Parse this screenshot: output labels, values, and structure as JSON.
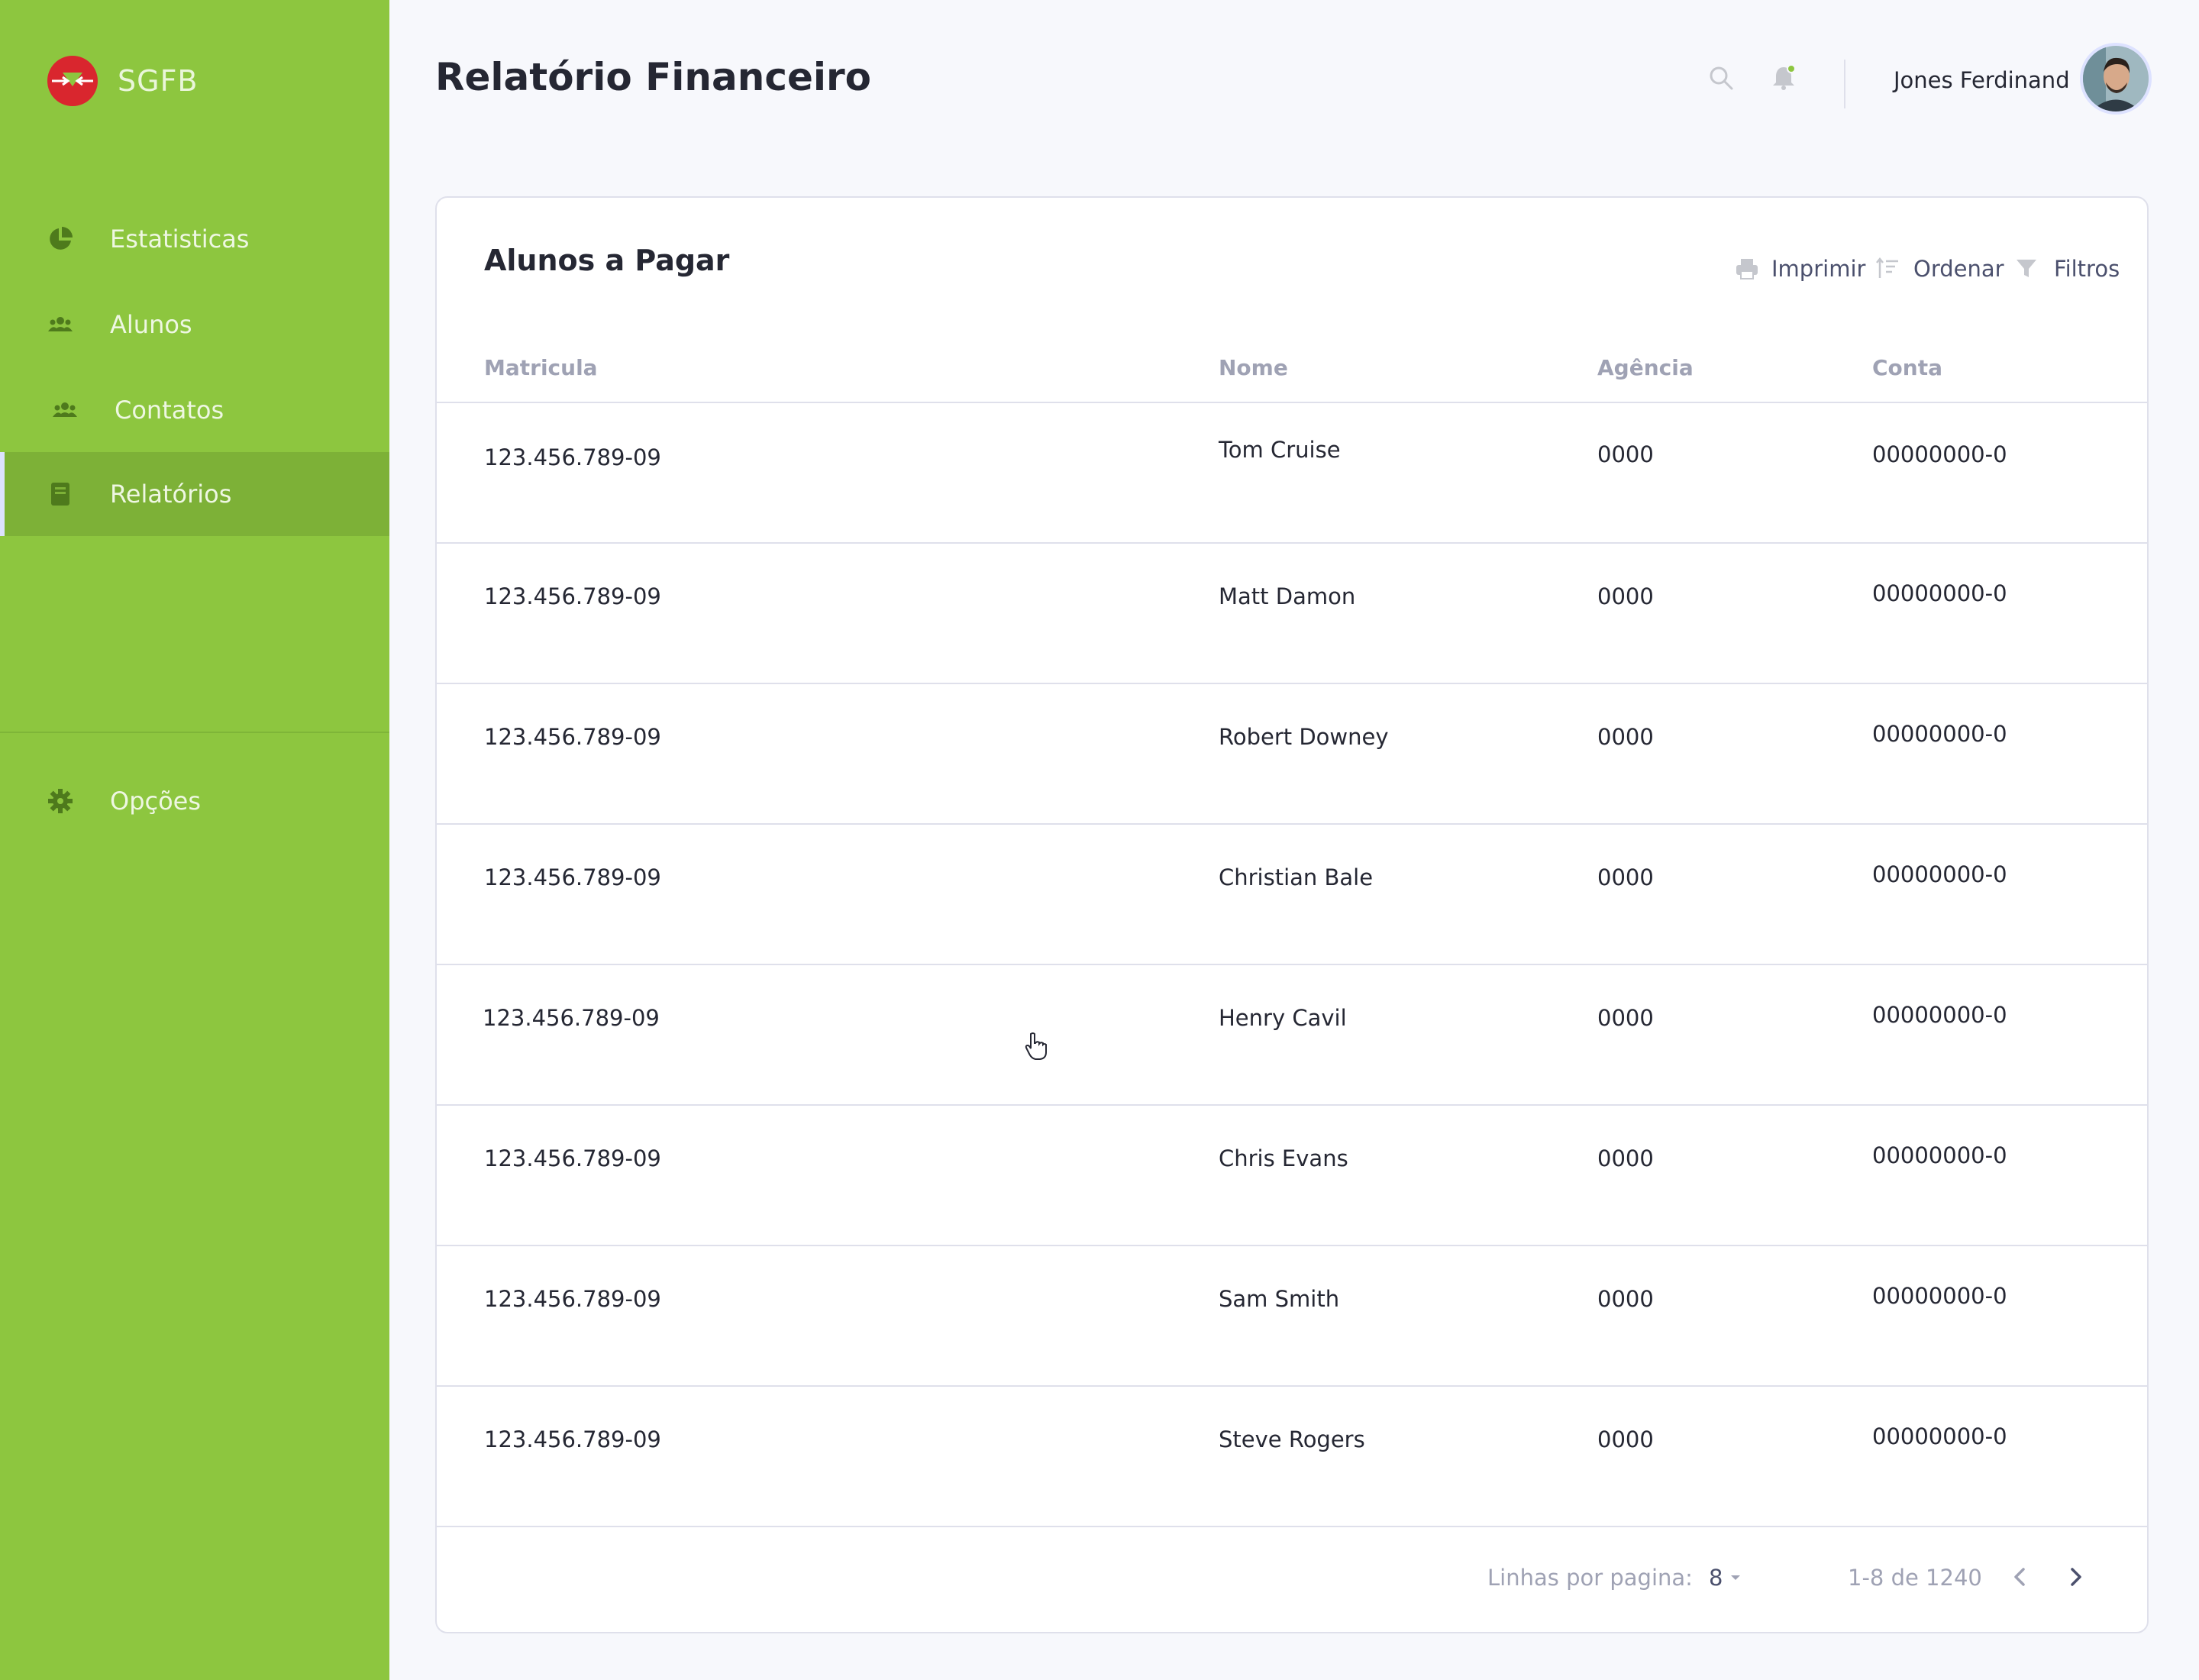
{
  "app": {
    "brand": "SGFB"
  },
  "sidebar": {
    "items": [
      {
        "label": "Estatisticas",
        "icon": "pie-chart-icon"
      },
      {
        "label": "Alunos",
        "icon": "users-icon"
      },
      {
        "label": "Contatos",
        "icon": "users-icon"
      },
      {
        "label": "Relatórios",
        "icon": "book-icon",
        "active": true
      }
    ],
    "options": {
      "label": "Opções",
      "icon": "gear-icon"
    }
  },
  "header": {
    "title": "Relatório Financeiro",
    "user_name": "Jones Ferdinand",
    "notification_dot_color": "#8DC63F"
  },
  "card": {
    "title": "Alunos a Pagar",
    "tools": {
      "print": "Imprimir",
      "sort": "Ordenar",
      "filter": "Filtros"
    },
    "columns": {
      "matricula": "Matricula",
      "nome": "Nome",
      "agencia": "Agência",
      "conta": "Conta"
    },
    "rows": [
      {
        "matricula": "123.456.789-09",
        "nome": "Tom Cruise",
        "agencia": "0000",
        "conta": "00000000-0"
      },
      {
        "matricula": "123.456.789-09",
        "nome": "Matt Damon",
        "agencia": "0000",
        "conta": "00000000-0"
      },
      {
        "matricula": "123.456.789-09",
        "nome": "Robert Downey",
        "agencia": "0000",
        "conta": "00000000-0"
      },
      {
        "matricula": "123.456.789-09",
        "nome": "Christian Bale",
        "agencia": "0000",
        "conta": "00000000-0"
      },
      {
        "matricula": "123.456.789-09",
        "nome": "Henry Cavil",
        "agencia": "0000",
        "conta": "00000000-0"
      },
      {
        "matricula": "123.456.789-09",
        "nome": "Chris Evans",
        "agencia": "0000",
        "conta": "00000000-0"
      },
      {
        "matricula": "123.456.789-09",
        "nome": "Sam Smith",
        "agencia": "0000",
        "conta": "00000000-0"
      },
      {
        "matricula": "123.456.789-09",
        "nome": "Steve Rogers",
        "agencia": "0000",
        "conta": "00000000-0"
      }
    ],
    "footer": {
      "rows_per_page_label": "Linhas por pagina:",
      "rows_per_page_value": "8",
      "range": "1-8 de 1240"
    }
  },
  "colors": {
    "sidebar": "#8DC63F",
    "sidebar_active": "#7DB137",
    "logo": "#D9262E"
  }
}
